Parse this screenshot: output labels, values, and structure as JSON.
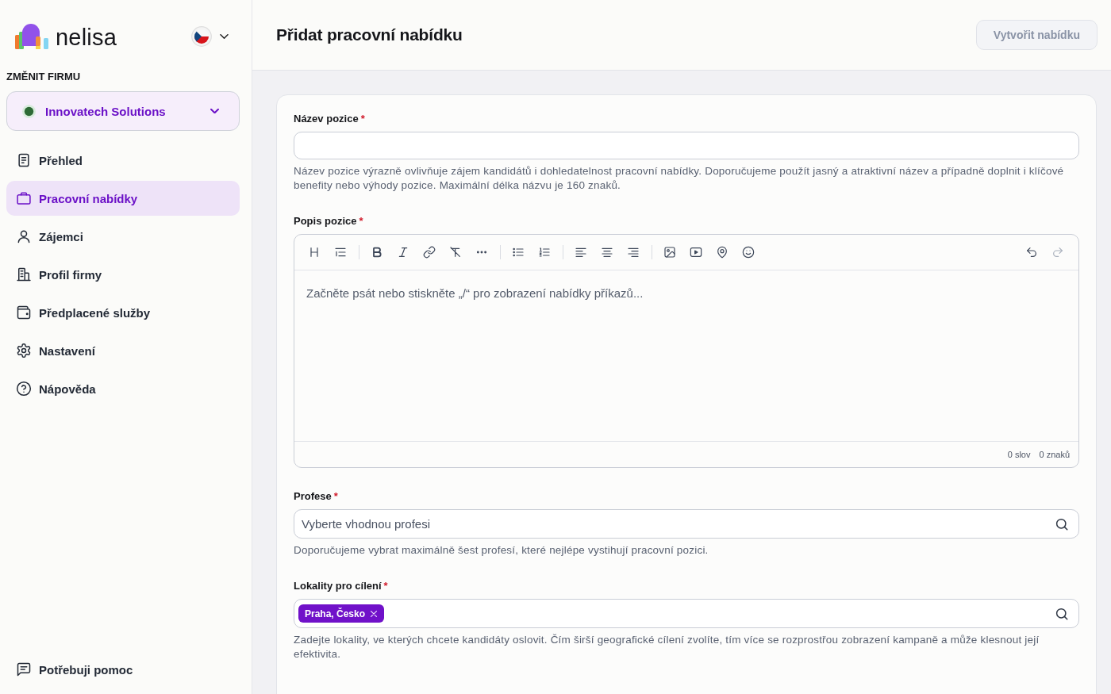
{
  "sidebar": {
    "logo": {
      "text": "nelisa"
    },
    "company_switcher": {
      "heading": "ZMĚNIT FIRMU",
      "value": "Innovatech Solutions"
    },
    "items": [
      {
        "label": "Přehled",
        "selected": false
      },
      {
        "label": "Pracovní nabídky",
        "selected": true
      },
      {
        "label": "Zájemci",
        "selected": false
      },
      {
        "label": "Profil firmy",
        "selected": false
      },
      {
        "label": "Předplacené služby",
        "selected": false
      },
      {
        "label": "Nastavení",
        "selected": false
      },
      {
        "label": "Nápověda",
        "selected": false
      }
    ],
    "help_link": {
      "label": "Potřebuji pomoc"
    }
  },
  "header": {
    "title": "Přidat pracovní nabídku",
    "create_button": {
      "label": "Vytvořit nabídku",
      "disabled": true
    }
  },
  "form": {
    "fields": [
      {
        "kind": "text",
        "label": "Název pozice",
        "required_mark": "*",
        "helper": "Název pozice výrazně ovlivňuje zájem kandidátů i dohledatelnost pracovní nabídky. Doporučujeme použít jasný a atraktivní název a případně doplnit i klíčové benefity nebo výhody pozice. Maximální délka názvu je 160 znaků."
      },
      {
        "kind": "editor",
        "label": "Popis pozice",
        "required_mark": "*",
        "placeholder": "Začněte psát nebo stiskněte „/“ pro zobrazení nabídky příkazů...",
        "undo": {
          "disabled": false
        },
        "redo": {
          "disabled": true
        },
        "word_count": "0 slov",
        "character_count": "0 znaků"
      },
      {
        "kind": "search",
        "label": "Profese",
        "required_mark": "*",
        "placeholder": "Vyberte vhodnou profesi",
        "helper": "Doporučujeme vybrat maximálně šest profesí, které nejlépe vystihují pracovní pozici."
      },
      {
        "kind": "tags",
        "label": "Lokality pro cílení",
        "required_mark": "*",
        "tags": [
          {
            "label": "Praha, Česko"
          }
        ],
        "helper": "Zadejte lokality, ve kterých chcete kandidáty oslovit. Čím širší geografické cílení zvolíte, tím více se rozprostřou zobrazení kampaně a může klesnout její efektivita."
      }
    ]
  }
}
